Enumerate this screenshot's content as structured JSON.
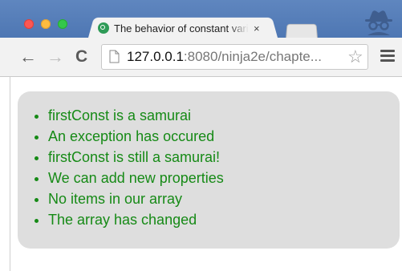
{
  "tab": {
    "title": "The behavior of constant variables",
    "close_glyph": "×"
  },
  "toolbar": {
    "back_glyph": "←",
    "forward_glyph": "→",
    "reload_glyph": "C",
    "url_host": "127.0.0.1",
    "url_path": ":8080/ninja2e/chapte...",
    "star_glyph": "☆"
  },
  "results": {
    "items": [
      "firstConst is a samurai",
      "An exception has occured",
      "firstConst is still a samurai!",
      "We can add new properties",
      "No items in our array",
      "The array has changed"
    ]
  },
  "colors": {
    "titlebar": "#5077b4",
    "result_text": "#168a16",
    "results_bg": "#dedede"
  },
  "icons": [
    "site-favicon-icon",
    "incognito-icon",
    "page-icon",
    "bookmark-star-icon",
    "menu-icon"
  ]
}
